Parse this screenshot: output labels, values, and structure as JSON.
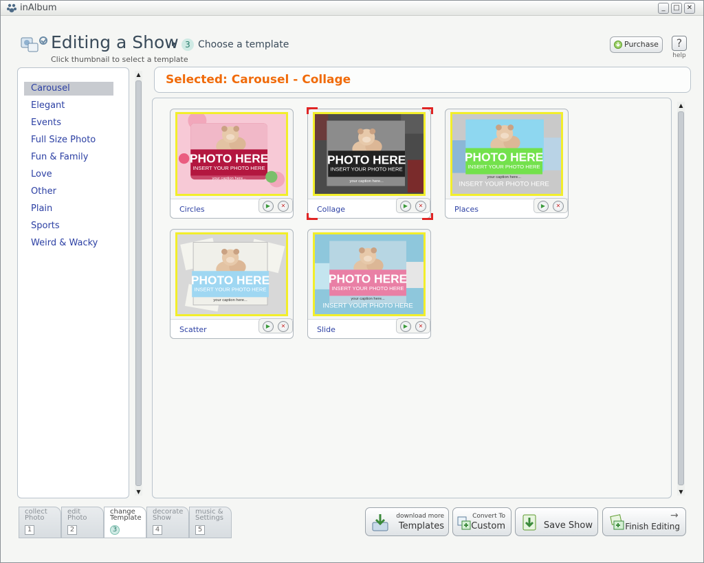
{
  "app": {
    "title": "inAlbum"
  },
  "window_controls": {
    "minimize": "_",
    "maximize": "□",
    "close": "✕"
  },
  "header": {
    "title": "Editing a Show",
    "step_number": "3",
    "step_label": "Choose a template",
    "subtitle": "Click thumbnail to select a template",
    "purchase_label": "Purchase",
    "help_label": "help"
  },
  "sidebar": {
    "categories": [
      {
        "label": "Carousel",
        "selected": true
      },
      {
        "label": "Elegant"
      },
      {
        "label": "Events"
      },
      {
        "label": "Full Size Photo"
      },
      {
        "label": "Fun & Family"
      },
      {
        "label": "Love"
      },
      {
        "label": "Other"
      },
      {
        "label": "Plain"
      },
      {
        "label": "Sports"
      },
      {
        "label": "Weird & Wacky"
      }
    ]
  },
  "selected_bar": {
    "text": "Selected: Carousel - Collage"
  },
  "templates": [
    {
      "name": "Circles",
      "selected": false
    },
    {
      "name": "Collage",
      "selected": true
    },
    {
      "name": "Places",
      "selected": false
    },
    {
      "name": "Scatter",
      "selected": false
    },
    {
      "name": "Slide",
      "selected": false
    }
  ],
  "thumbnail_text": {
    "photo_here": "PHOTO HERE",
    "insert": "INSERT YOUR PHOTO HERE",
    "caption": "your caption here..."
  },
  "step_tabs": [
    {
      "line1": "collect",
      "line2": "Photo",
      "number": "1"
    },
    {
      "line1": "edit",
      "line2": "Photo",
      "number": "2"
    },
    {
      "line1": "change",
      "line2": "Template",
      "number": "3",
      "active": true
    },
    {
      "line1": "decorate",
      "line2": "Show",
      "number": "4"
    },
    {
      "line1": "music &",
      "line2": "Settings",
      "number": "5"
    }
  ],
  "buttons": {
    "download_line1": "download more",
    "download_line2": "Templates",
    "convert_line1": "Convert To",
    "convert_line2": "Custom",
    "save_show": "Save Show",
    "finish_editing": "Finish Editing"
  },
  "colors": {
    "accent": "#f06b0a",
    "link": "#2b3fa3",
    "thumb_border": "#f2ee2a",
    "selection": "#e02424"
  }
}
